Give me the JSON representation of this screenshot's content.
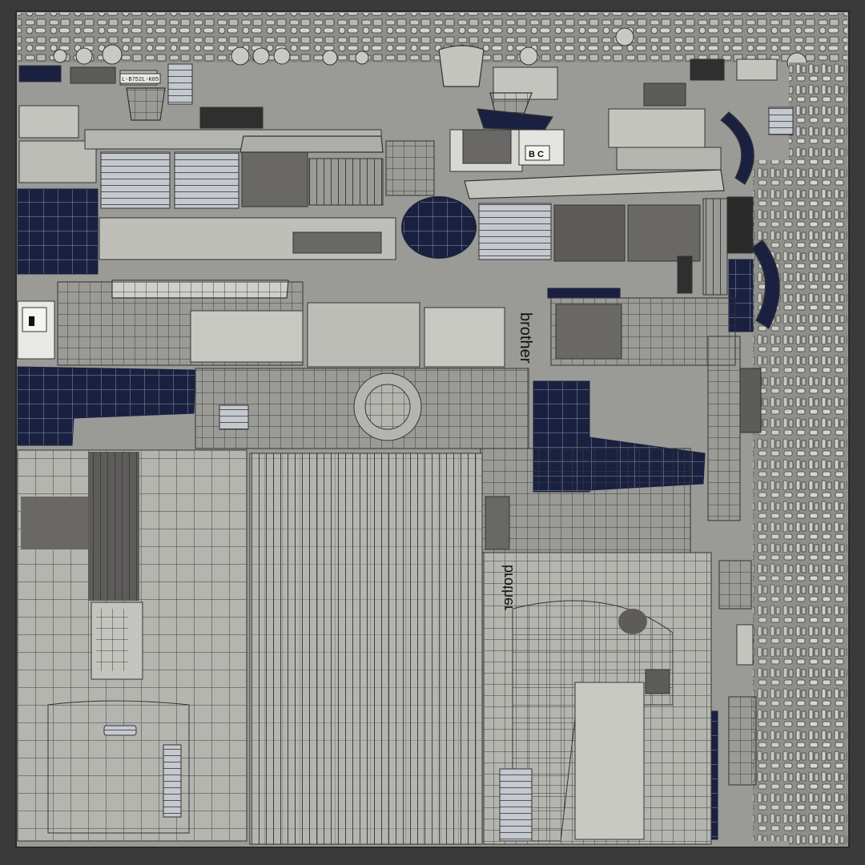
{
  "texture_sheet": {
    "colors": {
      "frame": "#3a3a3a",
      "base": "#9a9a96",
      "panel_light": "#c4c4bf",
      "panel_mid": "#b5b5b0",
      "panel_dark": "#5e5c5a",
      "wire": "#3e3e3e",
      "navy": "#1a2140",
      "navy_wire": "#8a93a8",
      "silver": "#bfc4cc"
    },
    "labels": {
      "brand_vertical": "brother",
      "brand_mirrored": "brother",
      "part_code": "L-B752L-K05",
      "icon_glyph": "B C",
      "panel_symbol": "█"
    },
    "icons": [
      "brand-logo-icon",
      "button-symbol-icon"
    ]
  }
}
